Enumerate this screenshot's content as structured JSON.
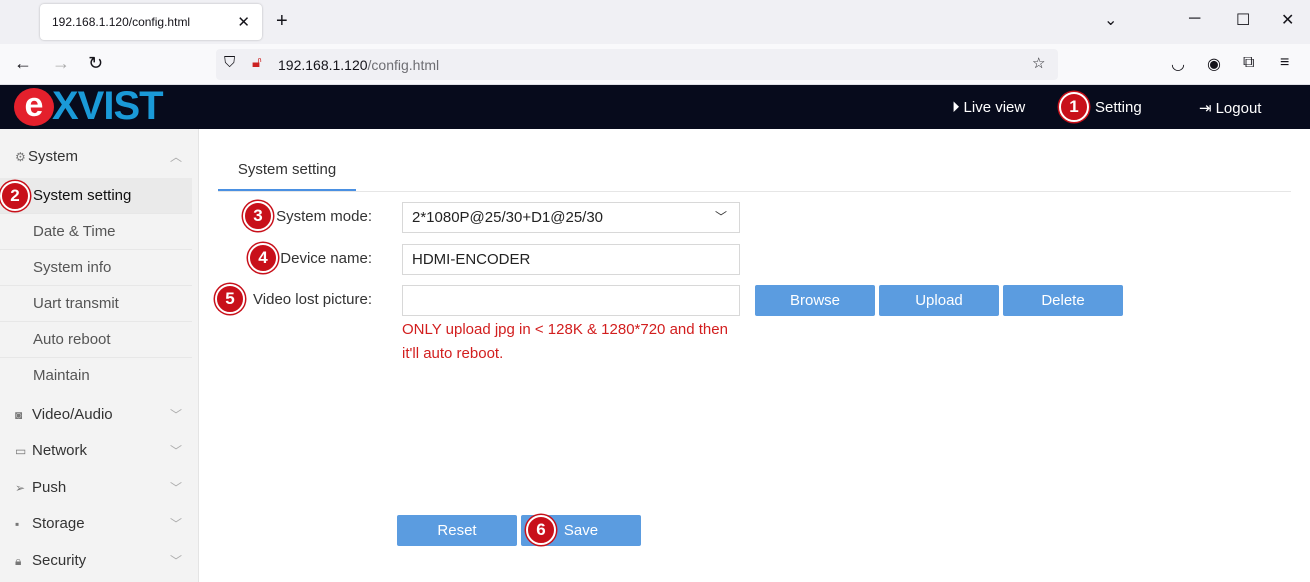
{
  "browser": {
    "tab_title": "192.168.1.120/config.html",
    "url_host": "192.168.1.120",
    "url_path": "/config.html"
  },
  "header": {
    "live_view": "Live view",
    "setting": "Setting",
    "logout": "Logout"
  },
  "logo": {
    "text": "XVIST",
    "mark": "e"
  },
  "sidebar": {
    "groups": [
      {
        "label": "System",
        "icon": "gear-icon"
      },
      {
        "label": "Video/Audio",
        "icon": "camera-icon"
      },
      {
        "label": "Network",
        "icon": "monitor-icon"
      },
      {
        "label": "Push",
        "icon": "send-icon"
      },
      {
        "label": "Storage",
        "icon": "disk-icon"
      },
      {
        "label": "Security",
        "icon": "lock-icon"
      }
    ],
    "items": [
      {
        "label": "System setting"
      },
      {
        "label": "Date & Time"
      },
      {
        "label": "System info"
      },
      {
        "label": "Uart transmit"
      },
      {
        "label": "Auto reboot"
      },
      {
        "label": "Maintain"
      }
    ]
  },
  "content": {
    "tab": "System setting",
    "fields": {
      "system_mode_label": "System mode:",
      "system_mode_value": "2*1080P@25/30+D1@25/30",
      "device_name_label": "Device name:",
      "device_name_value": "HDMI-ENCODER",
      "video_lost_label": "Video lost picture:",
      "video_lost_value": ""
    },
    "buttons": {
      "browse": "Browse",
      "upload": "Upload",
      "delete": "Delete",
      "reset": "Reset",
      "save": "Save"
    },
    "warning_line1": "ONLY upload jpg in < 128K & 1280*720 and then",
    "warning_line2": "it'll auto reboot."
  },
  "callouts": [
    "1",
    "2",
    "3",
    "4",
    "5",
    "6"
  ],
  "colors": {
    "header_bg": "#070b1c",
    "accent": "#5b9ce0",
    "callout": "#c8101a",
    "warning": "#d21e1e"
  }
}
